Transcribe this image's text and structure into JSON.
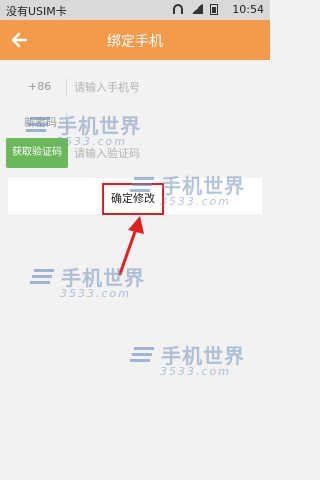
{
  "status_bar": {
    "carrier": "没有USIM卡",
    "time": "10:54"
  },
  "header": {
    "title": "绑定手机",
    "back_icon": "arrow-left-icon"
  },
  "form": {
    "country_code": "+86",
    "phone_placeholder": "请输入手机号",
    "password_label": "新密码",
    "get_code_label": "获取验证码",
    "code_placeholder": "请输入验证码"
  },
  "confirm_label": "确定修改",
  "watermark": {
    "main": "手机世界",
    "sub": "3533.com"
  },
  "colors": {
    "header": "#f39b4a",
    "code_button": "#6bb85a",
    "highlight": "#e02020"
  }
}
